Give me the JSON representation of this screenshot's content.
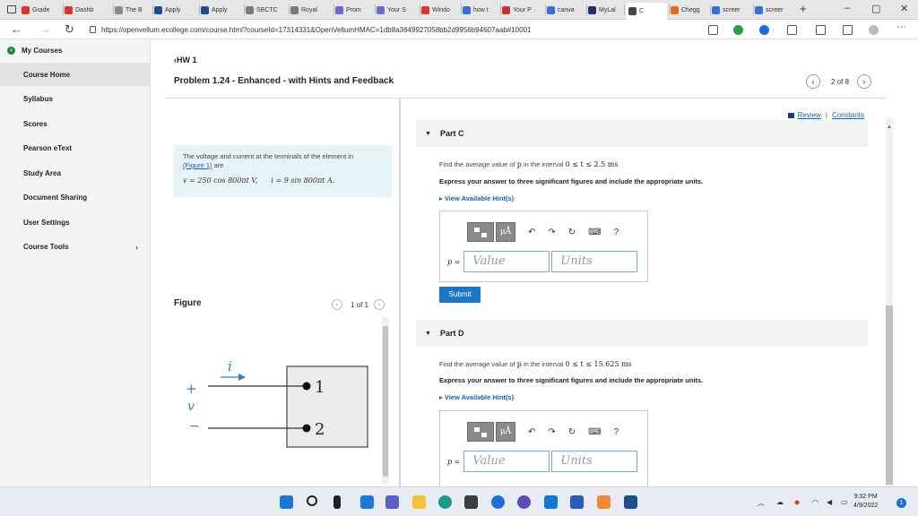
{
  "browser": {
    "tabs": [
      {
        "label": "Grade",
        "color": "#d9352b"
      },
      {
        "label": "Dashb",
        "color": "#d9352b"
      },
      {
        "label": "The B",
        "color": "#8c8c8c"
      },
      {
        "label": "Apply",
        "color": "#1f4e8c"
      },
      {
        "label": "Apply",
        "color": "#1f4e8c"
      },
      {
        "label": "SBCTC",
        "color": "#7a7a7a"
      },
      {
        "label": "Royal",
        "color": "#7a7a7a"
      },
      {
        "label": "Prom",
        "color": "#6a6ad0"
      },
      {
        "label": "Your S",
        "color": "#6a6ad0"
      },
      {
        "label": "Windo",
        "color": "#d9352b"
      },
      {
        "label": "how t",
        "color": "#3a6fd1"
      },
      {
        "label": "Your P",
        "color": "#c2342a"
      },
      {
        "label": "canva",
        "color": "#3a6fd1"
      },
      {
        "label": "MyLal",
        "color": "#222f6e"
      },
      {
        "label": "C",
        "color": "#444"
      },
      {
        "label": "Chegg",
        "color": "#e26b21"
      },
      {
        "label": "screer",
        "color": "#3a6fd1"
      },
      {
        "label": "screer",
        "color": "#3a6fd1"
      }
    ],
    "new_tab_label": "+",
    "minimize_label": "–",
    "restore_label": "▢",
    "close_label": "✕",
    "url": "https://openvellum.ecollege.com/course.html?courseId=17314331&OpenVellumHMAC=1db8a3649927058bb2d9956b94607aab#10001"
  },
  "sidebar": {
    "header": "My Courses",
    "items": [
      {
        "label": "Course Home",
        "selected": true
      },
      {
        "label": "Syllabus"
      },
      {
        "label": "Scores"
      },
      {
        "label": "Pearson eText"
      },
      {
        "label": "Study Area"
      },
      {
        "label": "Document Sharing"
      },
      {
        "label": "User Settings"
      },
      {
        "label": "Course Tools",
        "chevron": "›"
      }
    ]
  },
  "header": {
    "hw_link": "HW 1",
    "problem_title": "Problem 1.24 - Enhanced - with Hints and Feedback",
    "pager_text": "2 of 8",
    "prev": "‹",
    "next": "›"
  },
  "info": {
    "text_line1": "The voltage and current at the terminals of the element in",
    "figure_link": "(Figure 1)",
    "text_line2": " are",
    "eq_v": "v = 250 cos 800πt V,",
    "eq_i": "i = 9 sin 800πt A."
  },
  "figure": {
    "title": "Figure",
    "pager_text": "1 of 1",
    "prev": "‹",
    "next": "›",
    "current_label": "i",
    "plus": "+",
    "voltage_label": "v",
    "minus": "−",
    "terminal_1": "1",
    "terminal_2": "2"
  },
  "right": {
    "review_text": "Review",
    "divider": "|",
    "constants_text": "Constants",
    "part_c": {
      "title": "Part C",
      "question_prefix": "Find the average value of",
      "question_var": "p",
      "question_mid": "in the interval",
      "question_interval": "0 ≤ t ≤ 2.5 ms",
      "express": "Express your answer to three significant figures and include the appropriate units.",
      "hints": "View Available Hint(s)",
      "label": "p =",
      "value_placeholder": "Value",
      "units_placeholder": "Units",
      "submit": "Submit"
    },
    "part_d": {
      "title": "Part D",
      "question_prefix": "Find the average value of",
      "question_var": "p",
      "question_mid": "in the interval",
      "question_interval": "0 ≤ t ≤ 15.625 ms",
      "express": "Express your answer to three significant figures and include the appropriate units.",
      "hints": "View Available Hint(s)",
      "label": "p =",
      "value_placeholder": "Value",
      "units_placeholder": "Units"
    },
    "toolbar": {
      "mu_label": "μÅ",
      "undo": "↶",
      "redo": "↷",
      "reset": "↻",
      "keyboard": "⌨",
      "help": "?"
    }
  },
  "taskbar": {
    "time": "9:32 PM",
    "date": "4/9/2022",
    "notifications": "1"
  }
}
